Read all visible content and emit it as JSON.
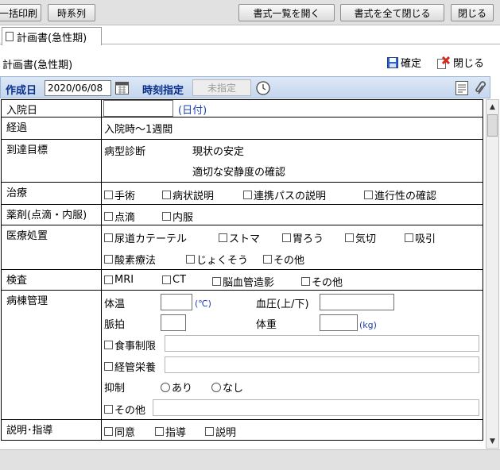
{
  "toolbar": {
    "print_all": "一括印刷",
    "timeline": "時系列",
    "open_list": "書式一覧を開く",
    "close_all": "書式を全て閉じる",
    "close": "閉じる"
  },
  "tab": {
    "label": "計画書(急性期)"
  },
  "page": {
    "title": "計画書(急性期)",
    "confirm_label": "確定",
    "close_label": "閉じる"
  },
  "datebar": {
    "created_label": "作成日",
    "created_value": "2020/06/08",
    "time_label": "時刻指定",
    "time_value": "未指定"
  },
  "form": {
    "admission": {
      "label": "入院日",
      "suffix": "(日付)"
    },
    "course": {
      "label": "経過",
      "value": "入院時～1週間"
    },
    "goal": {
      "label": "到達目標",
      "sub": "病型診断",
      "line1": "現状の安定",
      "line2": "適切な安静度の確認"
    },
    "treatment": {
      "label": "治療",
      "opts": [
        "手術",
        "病状説明",
        "連携パスの説明",
        "進行性の確認"
      ]
    },
    "drug": {
      "label": "薬剤(点滴・内服)",
      "opts": [
        "点滴",
        "内服"
      ]
    },
    "medproc": {
      "label": "医療処置",
      "opts_row1": [
        "尿道カテーテル",
        "ストマ",
        "胃ろう",
        "気切",
        "吸引"
      ],
      "opts_row2": [
        "酸素療法",
        "じょくそう",
        "その他"
      ]
    },
    "exam": {
      "label": "検査",
      "opts": [
        "MRI",
        "CT",
        "脳血管造影",
        "その他"
      ]
    },
    "ward": {
      "label": "病棟管理",
      "temp_label": "体温",
      "temp_unit": "(℃)",
      "bp_label": "血圧(上/下)",
      "pulse_label": "脈拍",
      "weight_label": "体重",
      "weight_unit": "(kg)",
      "diet_label": "食事制限",
      "tube_label": "経管栄養",
      "restraint_label": "抑制",
      "restraint_yes": "あり",
      "restraint_no": "なし",
      "other_label": "その他"
    },
    "explain": {
      "label": "説明･指導",
      "opts": [
        "同意",
        "指導",
        "説明"
      ]
    }
  }
}
